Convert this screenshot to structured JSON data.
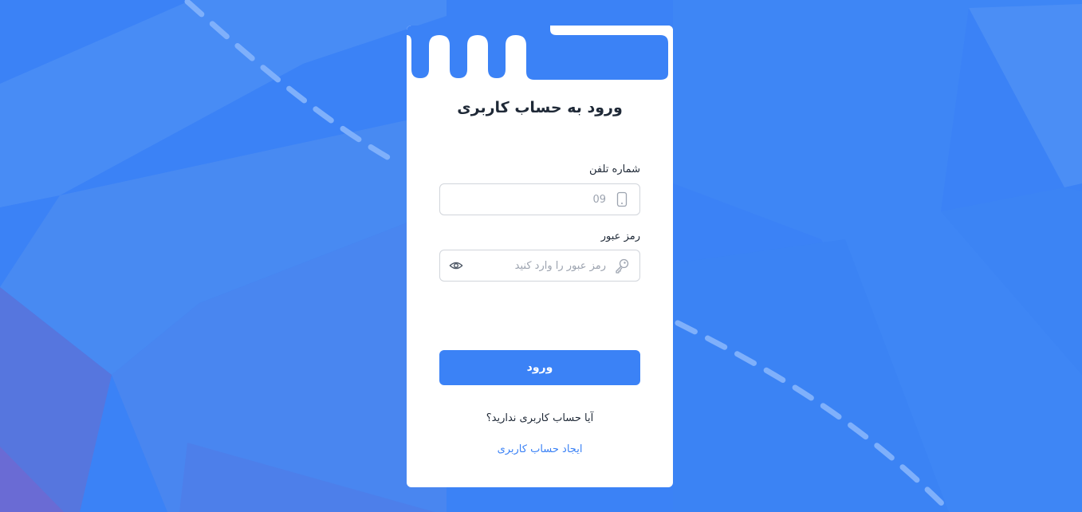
{
  "page": {
    "background_color": "#3b82f6",
    "accent_color": "#3b82f6"
  },
  "login": {
    "title": "ورود به حساب کاربری",
    "phone": {
      "label": "شماره تلفن",
      "placeholder": "09",
      "value": "",
      "icon": "mobile-phone-icon"
    },
    "password": {
      "label": "رمز عبور",
      "placeholder": "رمز عبور را وارد کنید",
      "value": "",
      "icon": "key-icon",
      "toggle_icon": "eye-icon"
    },
    "submit_label": "ورود",
    "no_account_text": "آیا حساب کاربری ندارید؟",
    "signup_link": "ایجاد حساب کاربری"
  }
}
